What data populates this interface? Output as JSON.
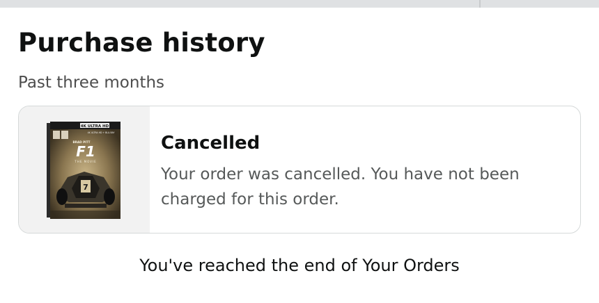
{
  "page": {
    "title": "Purchase history",
    "subtitle": "Past three months"
  },
  "order": {
    "status": "Cancelled",
    "message": "Your order was cancelled. You have not been charged for this order.",
    "product_image": {
      "badge": "4K ULTRA HD",
      "badge_sub": "4K ULTRA HD + BLU-RAY",
      "actor": "BRAD PITT",
      "logo": "F1",
      "tagline": "THE MOVIE",
      "car_number": "7"
    }
  },
  "footer": {
    "end_message": "You've reached the end of Your Orders"
  }
}
